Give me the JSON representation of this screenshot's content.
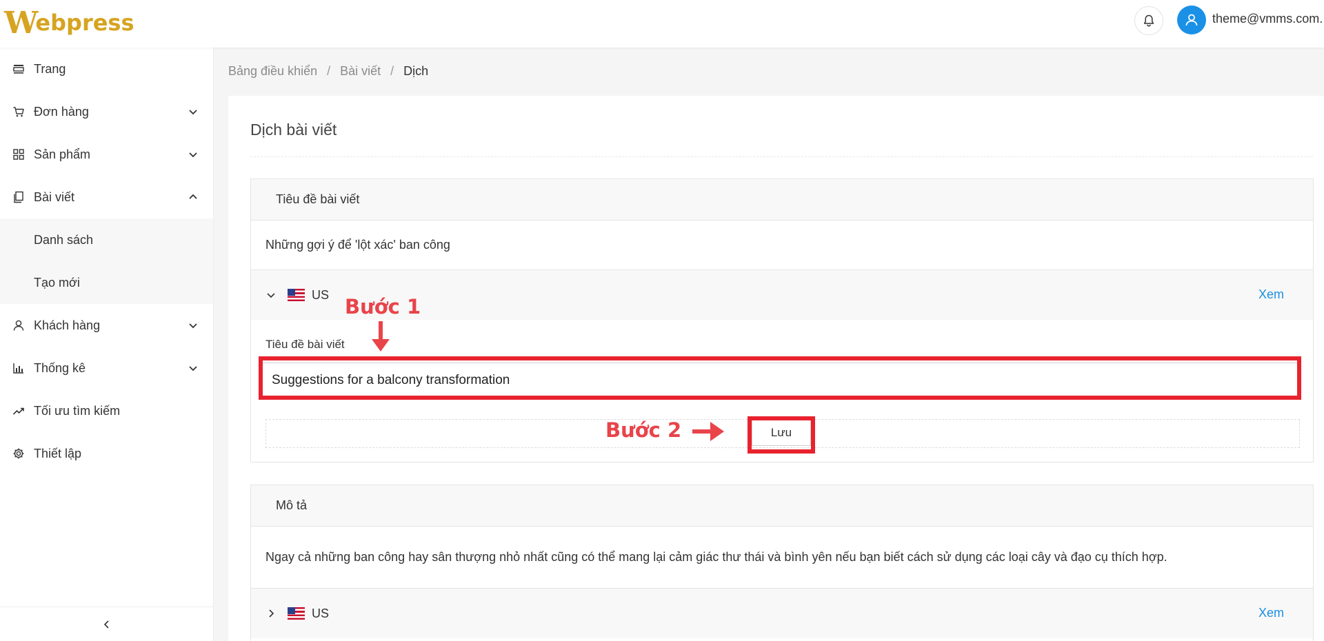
{
  "header": {
    "logo_initial": "W",
    "logo_rest": "ebpress",
    "user_email": "theme@vmms.com.",
    "bell_icon": "bell-icon",
    "avatar_icon": "user-icon"
  },
  "sidebar": {
    "items": [
      {
        "label": "Trang",
        "icon": "page-icon"
      },
      {
        "label": "Đơn hàng",
        "icon": "cart-icon"
      },
      {
        "label": "Sản phẩm",
        "icon": "grid-icon"
      },
      {
        "label": "Bài viết",
        "icon": "document-icon"
      },
      {
        "label": "Danh sách"
      },
      {
        "label": "Tạo mới"
      },
      {
        "label": "Khách hàng",
        "icon": "user-icon"
      },
      {
        "label": "Thống kê",
        "icon": "bar-chart-icon"
      },
      {
        "label": "Tối ưu tìm kiếm",
        "icon": "trend-icon"
      },
      {
        "label": "Thiết lập",
        "icon": "gear-icon"
      }
    ]
  },
  "breadcrumb": {
    "items": [
      "Bảng điều khiển",
      "Bài viết",
      "Dịch"
    ],
    "separator": "/"
  },
  "page": {
    "title": "Dịch bài viết"
  },
  "title_card": {
    "heading": "Tiêu đề bài viết",
    "original": "Những gợi ý để 'lột xác' ban công",
    "lang": "US",
    "view_label": "Xem",
    "field_label": "Tiêu đề bài viết",
    "input_value": "Suggestions for a balcony transformation",
    "save_label": "Lưu"
  },
  "desc_card": {
    "heading": "Mô tả",
    "original": "Ngay cả những ban công hay sân thượng nhỏ nhất cũng có thể mang lại cảm giác thư thái và bình yên nếu bạn biết cách sử dụng các loại cây và đạo cụ thích hợp.",
    "lang": "US",
    "view_label": "Xem"
  },
  "annotations": {
    "step1": "Bước 1",
    "step2": "Bước 2",
    "color": "#e8222e"
  }
}
